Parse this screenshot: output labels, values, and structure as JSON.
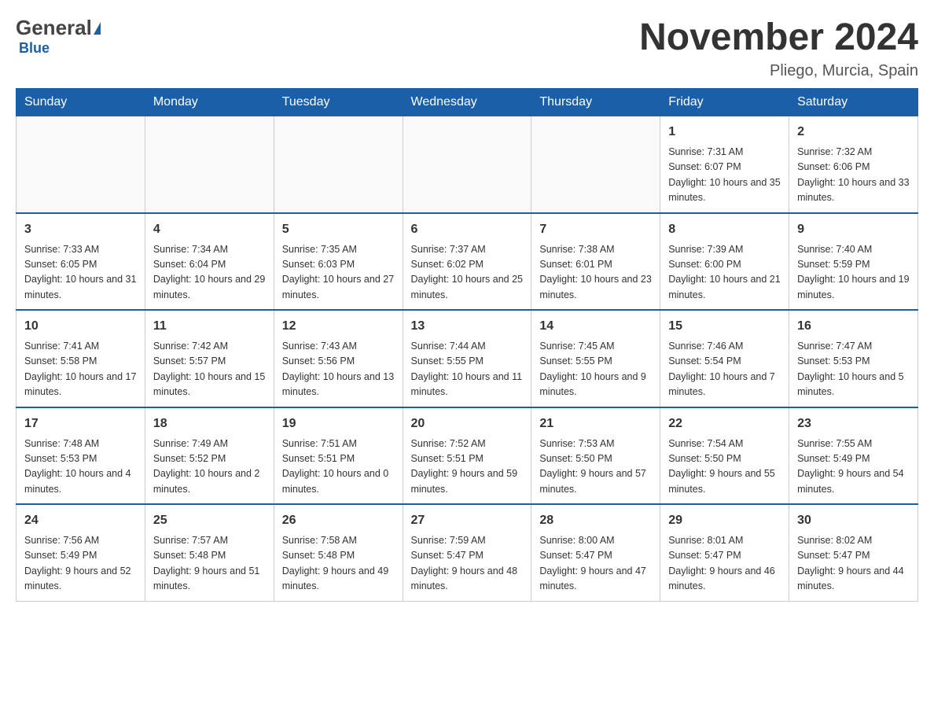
{
  "header": {
    "logo": {
      "general": "General",
      "blue": "Blue"
    },
    "title": "November 2024",
    "location": "Pliego, Murcia, Spain"
  },
  "weekdays": [
    "Sunday",
    "Monday",
    "Tuesday",
    "Wednesday",
    "Thursday",
    "Friday",
    "Saturday"
  ],
  "weeks": [
    {
      "days": [
        {
          "number": "",
          "sunrise": "",
          "sunset": "",
          "daylight": ""
        },
        {
          "number": "",
          "sunrise": "",
          "sunset": "",
          "daylight": ""
        },
        {
          "number": "",
          "sunrise": "",
          "sunset": "",
          "daylight": ""
        },
        {
          "number": "",
          "sunrise": "",
          "sunset": "",
          "daylight": ""
        },
        {
          "number": "",
          "sunrise": "",
          "sunset": "",
          "daylight": ""
        },
        {
          "number": "1",
          "sunrise": "Sunrise: 7:31 AM",
          "sunset": "Sunset: 6:07 PM",
          "daylight": "Daylight: 10 hours and 35 minutes."
        },
        {
          "number": "2",
          "sunrise": "Sunrise: 7:32 AM",
          "sunset": "Sunset: 6:06 PM",
          "daylight": "Daylight: 10 hours and 33 minutes."
        }
      ]
    },
    {
      "days": [
        {
          "number": "3",
          "sunrise": "Sunrise: 7:33 AM",
          "sunset": "Sunset: 6:05 PM",
          "daylight": "Daylight: 10 hours and 31 minutes."
        },
        {
          "number": "4",
          "sunrise": "Sunrise: 7:34 AM",
          "sunset": "Sunset: 6:04 PM",
          "daylight": "Daylight: 10 hours and 29 minutes."
        },
        {
          "number": "5",
          "sunrise": "Sunrise: 7:35 AM",
          "sunset": "Sunset: 6:03 PM",
          "daylight": "Daylight: 10 hours and 27 minutes."
        },
        {
          "number": "6",
          "sunrise": "Sunrise: 7:37 AM",
          "sunset": "Sunset: 6:02 PM",
          "daylight": "Daylight: 10 hours and 25 minutes."
        },
        {
          "number": "7",
          "sunrise": "Sunrise: 7:38 AM",
          "sunset": "Sunset: 6:01 PM",
          "daylight": "Daylight: 10 hours and 23 minutes."
        },
        {
          "number": "8",
          "sunrise": "Sunrise: 7:39 AM",
          "sunset": "Sunset: 6:00 PM",
          "daylight": "Daylight: 10 hours and 21 minutes."
        },
        {
          "number": "9",
          "sunrise": "Sunrise: 7:40 AM",
          "sunset": "Sunset: 5:59 PM",
          "daylight": "Daylight: 10 hours and 19 minutes."
        }
      ]
    },
    {
      "days": [
        {
          "number": "10",
          "sunrise": "Sunrise: 7:41 AM",
          "sunset": "Sunset: 5:58 PM",
          "daylight": "Daylight: 10 hours and 17 minutes."
        },
        {
          "number": "11",
          "sunrise": "Sunrise: 7:42 AM",
          "sunset": "Sunset: 5:57 PM",
          "daylight": "Daylight: 10 hours and 15 minutes."
        },
        {
          "number": "12",
          "sunrise": "Sunrise: 7:43 AM",
          "sunset": "Sunset: 5:56 PM",
          "daylight": "Daylight: 10 hours and 13 minutes."
        },
        {
          "number": "13",
          "sunrise": "Sunrise: 7:44 AM",
          "sunset": "Sunset: 5:55 PM",
          "daylight": "Daylight: 10 hours and 11 minutes."
        },
        {
          "number": "14",
          "sunrise": "Sunrise: 7:45 AM",
          "sunset": "Sunset: 5:55 PM",
          "daylight": "Daylight: 10 hours and 9 minutes."
        },
        {
          "number": "15",
          "sunrise": "Sunrise: 7:46 AM",
          "sunset": "Sunset: 5:54 PM",
          "daylight": "Daylight: 10 hours and 7 minutes."
        },
        {
          "number": "16",
          "sunrise": "Sunrise: 7:47 AM",
          "sunset": "Sunset: 5:53 PM",
          "daylight": "Daylight: 10 hours and 5 minutes."
        }
      ]
    },
    {
      "days": [
        {
          "number": "17",
          "sunrise": "Sunrise: 7:48 AM",
          "sunset": "Sunset: 5:53 PM",
          "daylight": "Daylight: 10 hours and 4 minutes."
        },
        {
          "number": "18",
          "sunrise": "Sunrise: 7:49 AM",
          "sunset": "Sunset: 5:52 PM",
          "daylight": "Daylight: 10 hours and 2 minutes."
        },
        {
          "number": "19",
          "sunrise": "Sunrise: 7:51 AM",
          "sunset": "Sunset: 5:51 PM",
          "daylight": "Daylight: 10 hours and 0 minutes."
        },
        {
          "number": "20",
          "sunrise": "Sunrise: 7:52 AM",
          "sunset": "Sunset: 5:51 PM",
          "daylight": "Daylight: 9 hours and 59 minutes."
        },
        {
          "number": "21",
          "sunrise": "Sunrise: 7:53 AM",
          "sunset": "Sunset: 5:50 PM",
          "daylight": "Daylight: 9 hours and 57 minutes."
        },
        {
          "number": "22",
          "sunrise": "Sunrise: 7:54 AM",
          "sunset": "Sunset: 5:50 PM",
          "daylight": "Daylight: 9 hours and 55 minutes."
        },
        {
          "number": "23",
          "sunrise": "Sunrise: 7:55 AM",
          "sunset": "Sunset: 5:49 PM",
          "daylight": "Daylight: 9 hours and 54 minutes."
        }
      ]
    },
    {
      "days": [
        {
          "number": "24",
          "sunrise": "Sunrise: 7:56 AM",
          "sunset": "Sunset: 5:49 PM",
          "daylight": "Daylight: 9 hours and 52 minutes."
        },
        {
          "number": "25",
          "sunrise": "Sunrise: 7:57 AM",
          "sunset": "Sunset: 5:48 PM",
          "daylight": "Daylight: 9 hours and 51 minutes."
        },
        {
          "number": "26",
          "sunrise": "Sunrise: 7:58 AM",
          "sunset": "Sunset: 5:48 PM",
          "daylight": "Daylight: 9 hours and 49 minutes."
        },
        {
          "number": "27",
          "sunrise": "Sunrise: 7:59 AM",
          "sunset": "Sunset: 5:47 PM",
          "daylight": "Daylight: 9 hours and 48 minutes."
        },
        {
          "number": "28",
          "sunrise": "Sunrise: 8:00 AM",
          "sunset": "Sunset: 5:47 PM",
          "daylight": "Daylight: 9 hours and 47 minutes."
        },
        {
          "number": "29",
          "sunrise": "Sunrise: 8:01 AM",
          "sunset": "Sunset: 5:47 PM",
          "daylight": "Daylight: 9 hours and 46 minutes."
        },
        {
          "number": "30",
          "sunrise": "Sunrise: 8:02 AM",
          "sunset": "Sunset: 5:47 PM",
          "daylight": "Daylight: 9 hours and 44 minutes."
        }
      ]
    }
  ]
}
